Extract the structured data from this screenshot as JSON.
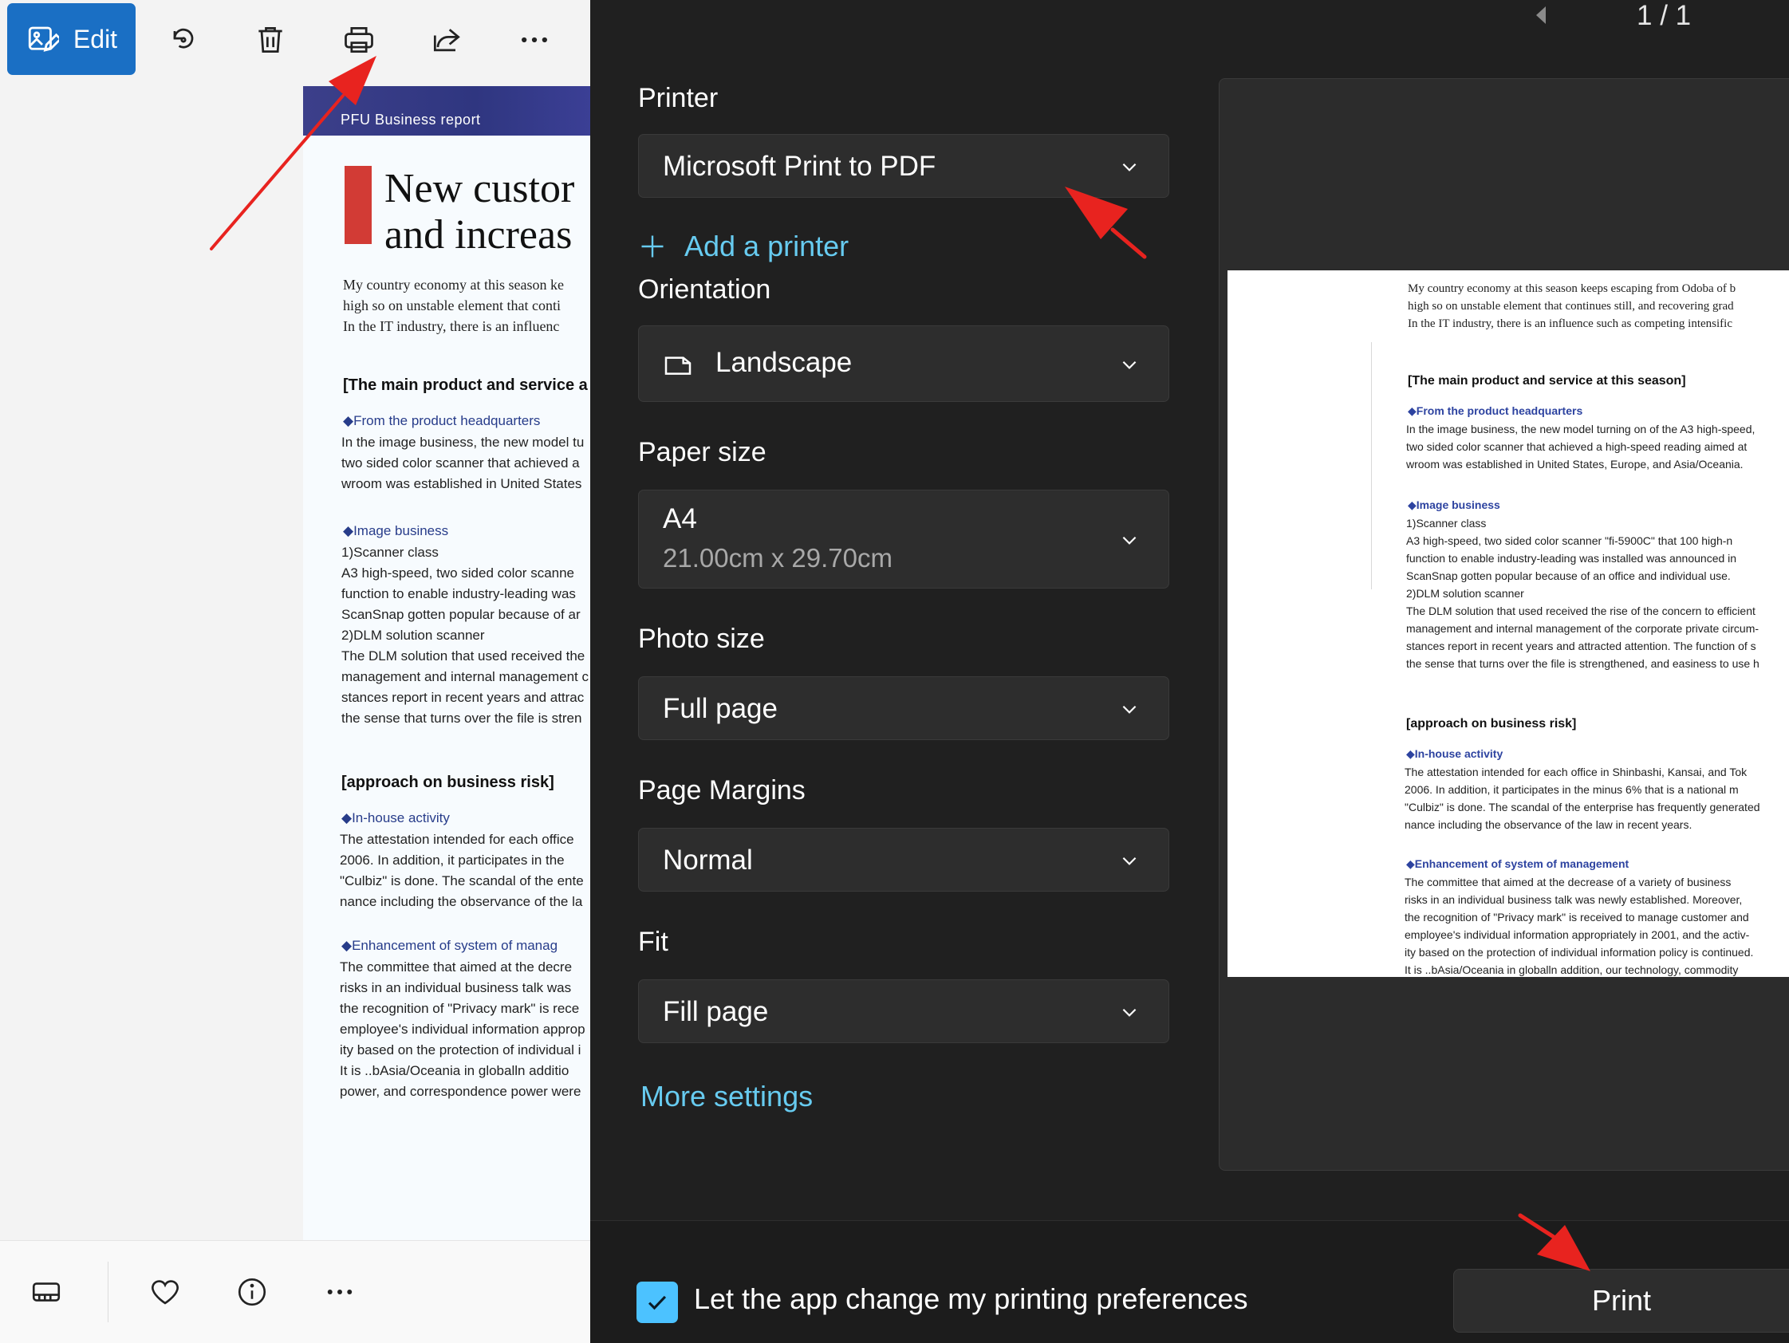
{
  "toolbar": {
    "edit_label": "Edit",
    "icons": [
      "edit-icon",
      "rotate-icon",
      "delete-icon",
      "print-icon",
      "share-icon",
      "more-icon"
    ]
  },
  "document": {
    "band_text": "PFU Business report",
    "headline": [
      "New custor",
      "and increas"
    ],
    "intro": [
      "My country economy at this season ke",
      "high so on unstable element that conti",
      "In the IT industry, there is an influenc"
    ],
    "section1": "[The main product and service a",
    "sub1": "◆From the product headquarters",
    "sub1_lines": [
      "In the image business, the new model tu",
      "two sided color scanner that achieved a",
      "wroom was established in United States"
    ],
    "sub2": "◆Image business",
    "sub2_lines": [
      "1)Scanner class",
      "A3 high-speed, two sided color scanne",
      "function to enable industry-leading was",
      "ScanSnap gotten popular because of ar",
      "2)DLM solution scanner",
      "The DLM solution that used received the",
      "management and internal management c",
      "stances report in recent years and attrac",
      "the sense that turns over the file is stren"
    ],
    "section2": "[approach on business risk]",
    "sub3": "◆In-house activity",
    "sub3_lines": [
      "The attestation intended for each office",
      "2006. In addition, it participates in the",
      "\"Culbiz\" is done. The scandal of the ente",
      "nance including the observance of the la"
    ],
    "sub4": "◆Enhancement of system of manag",
    "sub4_lines": [
      "The committee that aimed at the decre",
      "risks in an individual business talk was",
      "the recognition of \"Privacy mark\" is rece",
      "employee's individual information approp",
      "ity based on the protection of individual i",
      "It is ..bAsia/Oceania in globalln additio",
      "power, and correspondence power were"
    ]
  },
  "bottom_bar": {
    "icons": [
      "filmstrip-icon",
      "favorite-icon",
      "info-icon",
      "more-icon"
    ]
  },
  "print_dialog": {
    "page_counter": "1 / 1",
    "printer": {
      "label": "Printer",
      "value": "Microsoft Print to PDF"
    },
    "add_printer": "Add a printer",
    "orientation": {
      "label": "Orientation",
      "value": "Landscape"
    },
    "paper_size": {
      "label": "Paper size",
      "value": "A4",
      "dimensions": "21.00cm x 29.70cm"
    },
    "photo_size": {
      "label": "Photo size",
      "value": "Full page"
    },
    "page_margins": {
      "label": "Page Margins",
      "value": "Normal"
    },
    "fit": {
      "label": "Fit",
      "value": "Fill page"
    },
    "more_settings": "More settings",
    "preferences_checkbox": {
      "label": "Let the app change my printing preferences",
      "checked": true
    },
    "print_button": "Print"
  },
  "preview": {
    "intro": [
      "My country economy at this season keeps escaping from Odoba of b",
      "high so on unstable element that continues still, and recovering grad",
      "In the IT industry, there is an influence such as competing intensific"
    ],
    "section1": "[The main product and service at this season]",
    "sub1": "◆From the product headquarters",
    "sub1_lines": [
      "In the image business, the new model turning on of the A3 high-speed,",
      "two sided color scanner that achieved a high-speed reading aimed at",
      "wroom was established in United States, Europe, and Asia/Oceania."
    ],
    "sub2": "◆Image business",
    "sub2_lines": [
      "1)Scanner class",
      "A3 high-speed, two sided color scanner \"fi-5900C\" that 100 high-n",
      "function to enable industry-leading was installed was announced in",
      "ScanSnap gotten popular because of an office and individual use.",
      "2)DLM solution scanner",
      "The DLM solution that used received the rise of the concern to efficient",
      "management and internal management of the corporate private circum-",
      "stances report in recent years and attracted attention. The function of s",
      "the sense that turns over the file is strengthened, and easiness to use h"
    ],
    "section2": "[approach on business risk]",
    "sub3": "◆In-house activity",
    "sub3_lines": [
      "The attestation intended for each office in Shinbashi, Kansai, and Tok",
      "2006. In addition, it participates in the minus 6% that is a national m",
      "\"Culbiz\" is done. The scandal of the enterprise has frequently generated",
      "nance including the observance of the law in recent years."
    ],
    "sub4": "◆Enhancement of system of management",
    "sub4_lines": [
      "The committee that aimed at the decrease of a variety of business",
      "risks in an individual business talk was newly established. Moreover,",
      "the recognition of \"Privacy mark\" is received to manage customer and",
      "employee's individual information appropriately in 2001, and the activ-",
      "ity based on the protection of individual information policy is continued.",
      "It is ..bAsia/Oceania in globalln addition, our technology, commodity"
    ]
  },
  "colors": {
    "accent": "#1a6fc4",
    "link": "#67cbf0",
    "checkbox": "#4cc2ff",
    "annotation": "#e8231f"
  }
}
